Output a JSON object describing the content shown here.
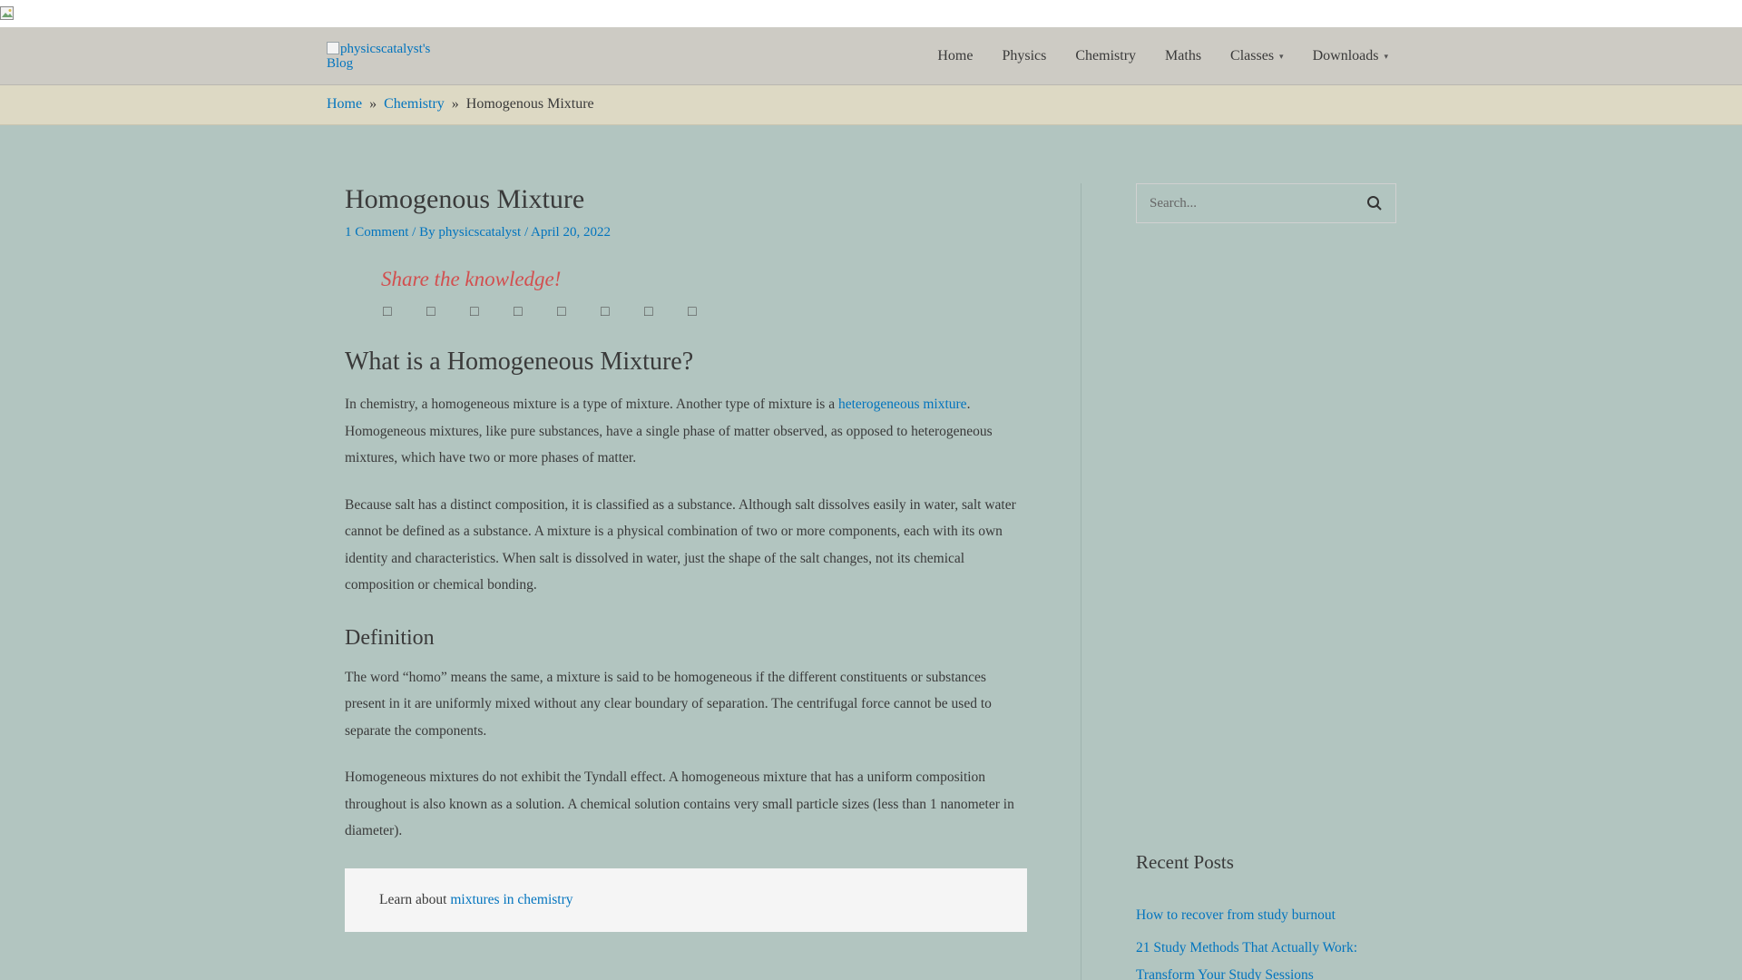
{
  "site": {
    "logo_alt": "physicscatalyst's Blog"
  },
  "nav": {
    "items": [
      {
        "label": "Home",
        "has_dropdown": false
      },
      {
        "label": "Physics",
        "has_dropdown": false
      },
      {
        "label": "Chemistry",
        "has_dropdown": false
      },
      {
        "label": "Maths",
        "has_dropdown": false
      },
      {
        "label": "Classes",
        "has_dropdown": true
      },
      {
        "label": "Downloads",
        "has_dropdown": true
      }
    ]
  },
  "breadcrumb": {
    "home": "Home",
    "sep": "»",
    "category": "Chemistry",
    "current": "Homogenous Mixture"
  },
  "article": {
    "title": "Homogenous Mixture",
    "meta": {
      "comments": "1 Comment",
      "by": " / By ",
      "author": "physicscatalyst",
      "sep": " / ",
      "date": "April 20, 2022"
    },
    "share": {
      "title": "Share the knowledge!",
      "icons": [
        "facebook-icon",
        "twitter-icon",
        "linkedin-icon",
        "pinterest-icon",
        "reddit-icon",
        "whatsapp-icon",
        "email-icon",
        "print-icon"
      ]
    },
    "h2": "What is a Homogeneous Mixture?",
    "p1_before": "In chemistry, a homogeneous mixture is a type of mixture. Another type of mixture is a ",
    "p1_link": "heterogeneous mixture",
    "p1_after": ". Homogeneous mixtures, like pure substances, have a single phase of matter observed, as opposed to heterogeneous mixtures, which have two or more phases of matter.",
    "p2": "Because salt has a distinct composition, it is classified as a substance. Although salt dissolves easily in water, salt water cannot be defined as a substance. A mixture is a physical combination of two or more components, each with its own identity and characteristics. When salt is dissolved in water, just the shape of the salt changes, not its chemical composition or chemical bonding.",
    "h3": "Definition",
    "p3": "The word “homo” means the same, a mixture is said to be homogeneous if the different constituents or substances present in it are uniformly mixed without any clear boundary of separation. The centrifugal force cannot be used to separate the components.",
    "p4": "Homogeneous mixtures do not exhibit the Tyndall effect. A homogeneous mixture that has a uniform composition throughout is also known as a solution. A chemical solution contains very small particle sizes (less than 1 nanometer in diameter).",
    "learn_text": "Learn about ",
    "learn_link": "mixtures in chemistry"
  },
  "sidebar": {
    "search_placeholder": "Search...",
    "recent_title": "Recent Posts",
    "recent_posts": [
      "How to recover from study burnout",
      "21 Study Methods That Actually Work: Transform Your Study Sessions"
    ]
  },
  "colors": {
    "link": "#0274be",
    "share_title": "#d24f4f",
    "background": "#b2c5c0"
  }
}
